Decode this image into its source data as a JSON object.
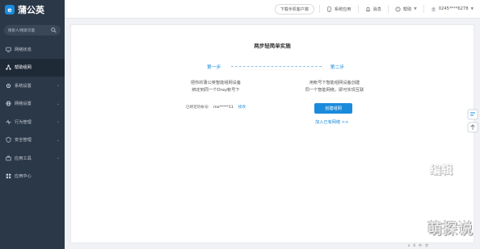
{
  "brand": {
    "name": "蒲公英",
    "mark": "e"
  },
  "sidebar": {
    "search_placeholder": "搜索人/搜索页面",
    "items": [
      {
        "label": "网络状态",
        "icon": "monitor-icon"
      },
      {
        "label": "帮助组网",
        "icon": "network-icon"
      },
      {
        "label": "系统设置",
        "icon": "gear-icon"
      },
      {
        "label": "网络设置",
        "icon": "globe-icon"
      },
      {
        "label": "行为管理",
        "icon": "activity-icon"
      },
      {
        "label": "安全管理",
        "icon": "shield-icon"
      },
      {
        "label": "应用工具",
        "icon": "toolbox-icon"
      },
      {
        "label": "应用中心",
        "icon": "grid-icon"
      }
    ]
  },
  "topbar": {
    "download": "下载手机客户端",
    "system_apps": "系统应用",
    "messages": "消息",
    "help": "帮助",
    "user": "0245****6278"
  },
  "main": {
    "title": "两步轻简单实施",
    "step1": "第一步",
    "step2": "第二步",
    "step1_desc_1": "把你的蒲公英智能组网设备",
    "step1_desc_2": "绑定到同一个Oray帐号下",
    "step2_desc_1": "用帐号下智能组网设备创建",
    "step2_desc_2": "同一个智能网络，即可实现互联",
    "acct_label": "已绑定的帐号：",
    "acct_value": "mo*****11",
    "acct_modify": "修改",
    "create_button": "创建组网",
    "join_link": "加入已有网络 >>"
  },
  "watermark": {
    "text": "萌探说",
    "text2": "编辑"
  },
  "footer": {
    "items": [
      "e",
      "6",
      "中",
      "字"
    ]
  }
}
